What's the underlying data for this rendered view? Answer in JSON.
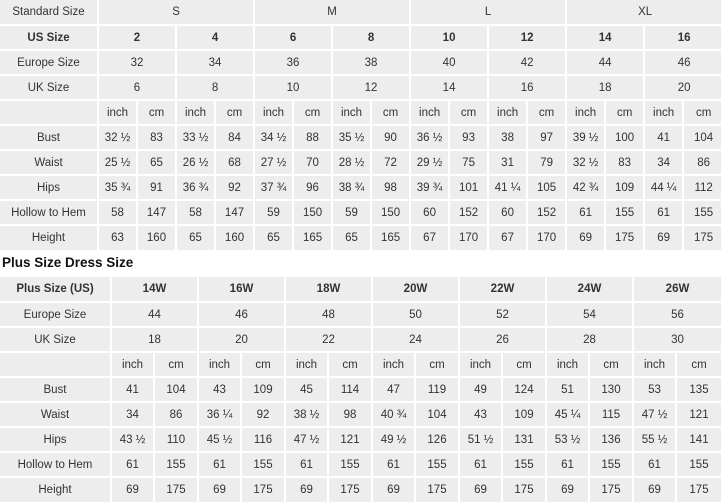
{
  "standard_table": {
    "group_header": {
      "label": "Standard Size",
      "groups": [
        "S",
        "M",
        "L",
        "XL"
      ]
    },
    "rows": [
      {
        "label": "US Size",
        "bold": true,
        "values": [
          "2",
          "4",
          "6",
          "8",
          "10",
          "12",
          "14",
          "16"
        ]
      },
      {
        "label": "Europe Size",
        "bold": false,
        "values": [
          "32",
          "34",
          "36",
          "38",
          "40",
          "42",
          "44",
          "46"
        ]
      },
      {
        "label": "UK Size",
        "bold": false,
        "values": [
          "6",
          "8",
          "10",
          "12",
          "14",
          "16",
          "18",
          "20"
        ]
      }
    ],
    "unit_row": {
      "label": "",
      "units": [
        "inch",
        "cm",
        "inch",
        "cm",
        "inch",
        "cm",
        "inch",
        "cm",
        "inch",
        "cm",
        "inch",
        "cm",
        "inch",
        "cm",
        "inch",
        "cm"
      ]
    },
    "measure_rows": [
      {
        "label": "Bust",
        "values": [
          "32 ½",
          "83",
          "33 ½",
          "84",
          "34 ½",
          "88",
          "35 ½",
          "90",
          "36 ½",
          "93",
          "38",
          "97",
          "39 ½",
          "100",
          "41",
          "104"
        ]
      },
      {
        "label": "Waist",
        "values": [
          "25 ½",
          "65",
          "26 ½",
          "68",
          "27 ½",
          "70",
          "28 ½",
          "72",
          "29 ½",
          "75",
          "31",
          "79",
          "32 ½",
          "83",
          "34",
          "86"
        ]
      },
      {
        "label": "Hips",
        "values": [
          "35 ¾",
          "91",
          "36 ¾",
          "92",
          "37 ¾",
          "96",
          "38 ¾",
          "98",
          "39 ¾",
          "101",
          "41 ¼",
          "105",
          "42 ¾",
          "109",
          "44 ¼",
          "112"
        ]
      },
      {
        "label": "Hollow to Hem",
        "values": [
          "58",
          "147",
          "58",
          "147",
          "59",
          "150",
          "59",
          "150",
          "60",
          "152",
          "60",
          "152",
          "61",
          "155",
          "61",
          "155"
        ]
      },
      {
        "label": "Height",
        "values": [
          "63",
          "160",
          "65",
          "160",
          "65",
          "165",
          "65",
          "165",
          "67",
          "170",
          "67",
          "170",
          "69",
          "175",
          "69",
          "175"
        ]
      }
    ]
  },
  "plus_section": {
    "title": "Plus Size Dress Size"
  },
  "plus_table": {
    "rows": [
      {
        "label": "Plus Size (US)",
        "bold": true,
        "values": [
          "14W",
          "16W",
          "18W",
          "20W",
          "22W",
          "24W",
          "26W"
        ]
      },
      {
        "label": "Europe Size",
        "bold": false,
        "values": [
          "44",
          "46",
          "48",
          "50",
          "52",
          "54",
          "56"
        ]
      },
      {
        "label": "UK Size",
        "bold": false,
        "values": [
          "18",
          "20",
          "22",
          "24",
          "26",
          "28",
          "30"
        ]
      }
    ],
    "unit_row": {
      "label": "",
      "units": [
        "inch",
        "cm",
        "inch",
        "cm",
        "inch",
        "cm",
        "inch",
        "cm",
        "inch",
        "cm",
        "inch",
        "cm",
        "inch",
        "cm"
      ]
    },
    "measure_rows": [
      {
        "label": "Bust",
        "values": [
          "41",
          "104",
          "43",
          "109",
          "45",
          "114",
          "47",
          "119",
          "49",
          "124",
          "51",
          "130",
          "53",
          "135"
        ]
      },
      {
        "label": "Waist",
        "values": [
          "34",
          "86",
          "36 ¼",
          "92",
          "38 ½",
          "98",
          "40 ¾",
          "104",
          "43",
          "109",
          "45 ¼",
          "115",
          "47 ½",
          "121"
        ]
      },
      {
        "label": "Hips",
        "values": [
          "43 ½",
          "110",
          "45 ½",
          "116",
          "47 ½",
          "121",
          "49 ½",
          "126",
          "51 ½",
          "131",
          "53 ½",
          "136",
          "55 ½",
          "141"
        ]
      },
      {
        "label": "Hollow to Hem",
        "values": [
          "61",
          "155",
          "61",
          "155",
          "61",
          "155",
          "61",
          "155",
          "61",
          "155",
          "61",
          "155",
          "61",
          "155"
        ]
      },
      {
        "label": "Height",
        "values": [
          "69",
          "175",
          "69",
          "175",
          "69",
          "175",
          "69",
          "175",
          "69",
          "175",
          "69",
          "175",
          "69",
          "175"
        ]
      }
    ]
  }
}
